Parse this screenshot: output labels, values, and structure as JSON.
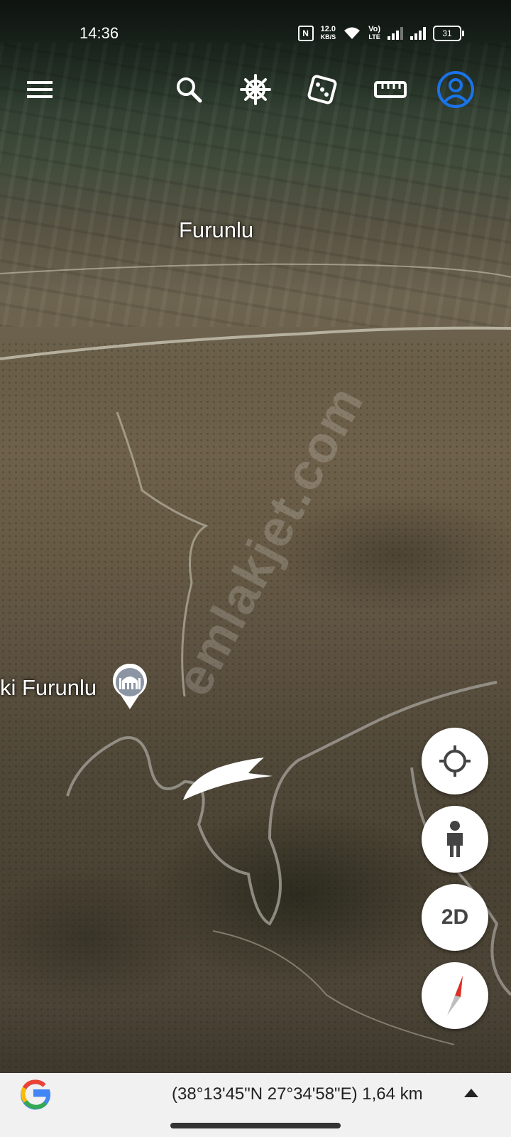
{
  "status_bar": {
    "time": "14:36",
    "nfc_label": "N",
    "net_speed_value": "12.0",
    "net_speed_unit": "KB/S",
    "volte_top": "Vo)",
    "volte_bottom": "LTE",
    "battery": "31"
  },
  "toolbar": {
    "icons": [
      "menu-icon",
      "search-icon",
      "voyager-ship-wheel-icon",
      "dice-icon",
      "ruler-icon",
      "account-icon"
    ]
  },
  "map": {
    "labels": {
      "town": "Furunlu",
      "poi": "ki Furunlu"
    },
    "watermark": "emlakjet.com"
  },
  "controls": {
    "mode_button": "2D"
  },
  "bottom_bar": {
    "coordinates": "(38°13'45\"N 27°34'58\"E) 1,64 km"
  },
  "colors": {
    "accent_blue": "#1a73e8",
    "compass_red": "#d93025",
    "bar_background": "#f1f1f1"
  }
}
